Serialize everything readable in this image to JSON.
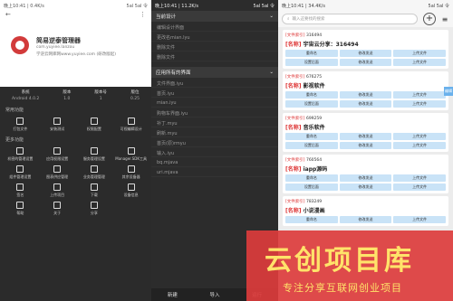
{
  "panel1": {
    "status": {
      "left": "晚上10:41 | 0.4K/s",
      "right": "5al 5al 令"
    },
    "toolbar": {
      "back": "←",
      "more": "⋮"
    },
    "app": {
      "title": "简易逆泰管理器",
      "package": "com.yuyiee.lanzou",
      "desc": "学逆云网库网www.yuyiee.com (研改版起)"
    },
    "info": [
      {
        "label": "系统",
        "value": "Android 4.0.2"
      },
      {
        "label": "版本",
        "value": "1.0"
      },
      {
        "label": "版本号",
        "value": "1"
      },
      {
        "label": "版位",
        "value": "0.25"
      }
    ],
    "section1": "常用功能",
    "grid1": [
      "打包文件",
      "安装测试",
      "权限配置",
      "可视编辑设计"
    ],
    "section2": "更多功能",
    "grid2": [
      "机密的管理设置",
      "应用权限设置",
      "服务管理设置",
      "Manager.SDK工具",
      "组件管理设置",
      "图表供应管理",
      "业务管理管理",
      "其余设备器",
      "签名",
      "上传项目",
      "下载",
      "设备信息",
      "帮助",
      "关于",
      "分享"
    ]
  },
  "panel2": {
    "status": {
      "left": "晚上10:41 | 11.2K/s",
      "right": "5al 5al 令"
    },
    "header1": "当前设计",
    "items1": [
      "编辑设计界面",
      "更改名mian.lyu",
      "删除文件",
      "删除文件"
    ],
    "header2": "应用所有的界面",
    "items2": [
      "文件界面.iyu",
      "首页.iyu",
      "mian.iyu",
      "购物车界面.iyu",
      "补丁.myu",
      "刷新.myu",
      "首页(原)rmyu",
      "输入.iyu",
      "bq.mjava",
      "uri.mjava"
    ],
    "bottom": [
      "新建",
      "导入",
      "运行"
    ]
  },
  "panel3": {
    "status": {
      "left": "晚上10:41 | 34.4K/s",
      "right": "5al 5al 令"
    },
    "search_placeholder": "输入这要找的搜索",
    "side_tab": "编辑",
    "cards": [
      {
        "id_label": "[文件索引]",
        "id": "316494",
        "name_label": "[名称]",
        "name": "宇宙云分享：316494",
        "buttons": [
          "重命名",
          "修改发送",
          "上传文件",
          "设置后面",
          "修改发送",
          "上传文件"
        ]
      },
      {
        "id_label": "[文件索引]",
        "id": "676275",
        "name_label": "[名称]",
        "name": "影视软件",
        "buttons": [
          "重命名",
          "修改发送",
          "上传文件",
          "设置后面",
          "修改发送",
          "上传文件"
        ]
      },
      {
        "id_label": "[文件索引]",
        "id": "699259",
        "name_label": "[名称]",
        "name": "音乐软件",
        "buttons": [
          "重命名",
          "修改发送",
          "上传文件",
          "设置后面",
          "修改发送",
          "上传文件"
        ]
      },
      {
        "id_label": "[文件索引]",
        "id": "760564",
        "name_label": "[名称]",
        "name": "iapp源码",
        "buttons": [
          "重命名",
          "修改发送",
          "上传文件",
          "设置后面",
          "修改发送",
          "上传文件"
        ]
      },
      {
        "id_label": "[文件索引]",
        "id": "783249",
        "name_label": "[名称]",
        "name": "小说漫画",
        "buttons": [
          "重命名",
          "修改发送",
          "上传文件",
          "设置后面",
          "修改发送",
          "上传文件"
        ]
      }
    ]
  },
  "watermark": {
    "main": "云创项目库",
    "sub": "专注分享互联网创业项目"
  }
}
